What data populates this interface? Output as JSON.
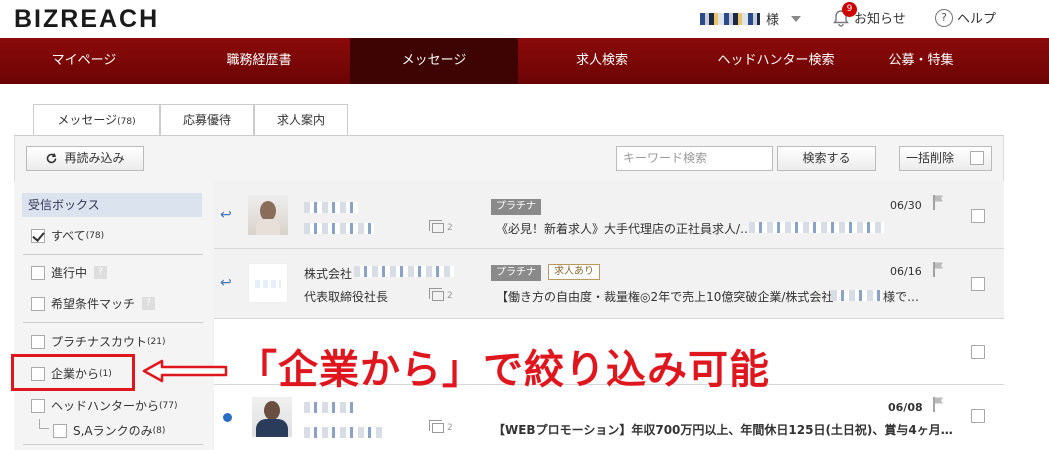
{
  "header": {
    "logo": "BIZREACH",
    "user_suffix": "様",
    "notice_label": "お知らせ",
    "notice_count": "9",
    "help_label": "ヘルプ"
  },
  "nav": [
    "マイページ",
    "職務経歴書",
    "メッセージ",
    "求人検索",
    "ヘッドハンター検索",
    "公募・特集"
  ],
  "tabs": [
    {
      "label": "メッセージ",
      "count": "(78)"
    },
    {
      "label": "応募優待"
    },
    {
      "label": "求人案内"
    }
  ],
  "toolbar": {
    "reload_label": "再読み込み",
    "search_placeholder": "キーワード検索",
    "search_button": "検索する",
    "bulk_delete": "一括削除"
  },
  "sidebar": {
    "inbox": "受信ボックス",
    "all": {
      "label": "すべて",
      "count": "(78)"
    },
    "in_progress": "進行中",
    "match": "希望条件マッチ",
    "q": "?",
    "platinum": {
      "label": "プラチナスカウト",
      "count": "(21)"
    },
    "company": {
      "label": "企業から",
      "count": "(1)"
    },
    "headhunter": {
      "label": "ヘッドハンターから",
      "count": "(77)"
    },
    "sa_rank": {
      "label": "S,Aランクのみ",
      "count": "(8)"
    }
  },
  "messages": [
    {
      "badge": "プラチナ",
      "subject": "《必見！新着求人》大手代理店の正社員求人/…",
      "date": "06/30",
      "count": "2"
    },
    {
      "company": "株式会社",
      "title": "代表取締役社長",
      "badge": "プラチナ",
      "badge2": "求人あり",
      "subject": "【働き方の自由度・裁量権◎2年で売上10億突破企業/株式会社",
      "subject_end": "様で…",
      "date": "06/16",
      "count": "2"
    },
    {
      "subject": "【WEBプロモーション】年収700万円以上、年間休日125日(土日祝)、賞与4ヶ月…",
      "date": "06/08",
      "count": "2"
    }
  ],
  "annotation": "「企業から」で絞り込み可能",
  "colors": {
    "nav": "#7a0707",
    "nav_active": "#3e0303",
    "accent": "#e0161e",
    "inbox_bg": "#dbe3ee"
  }
}
